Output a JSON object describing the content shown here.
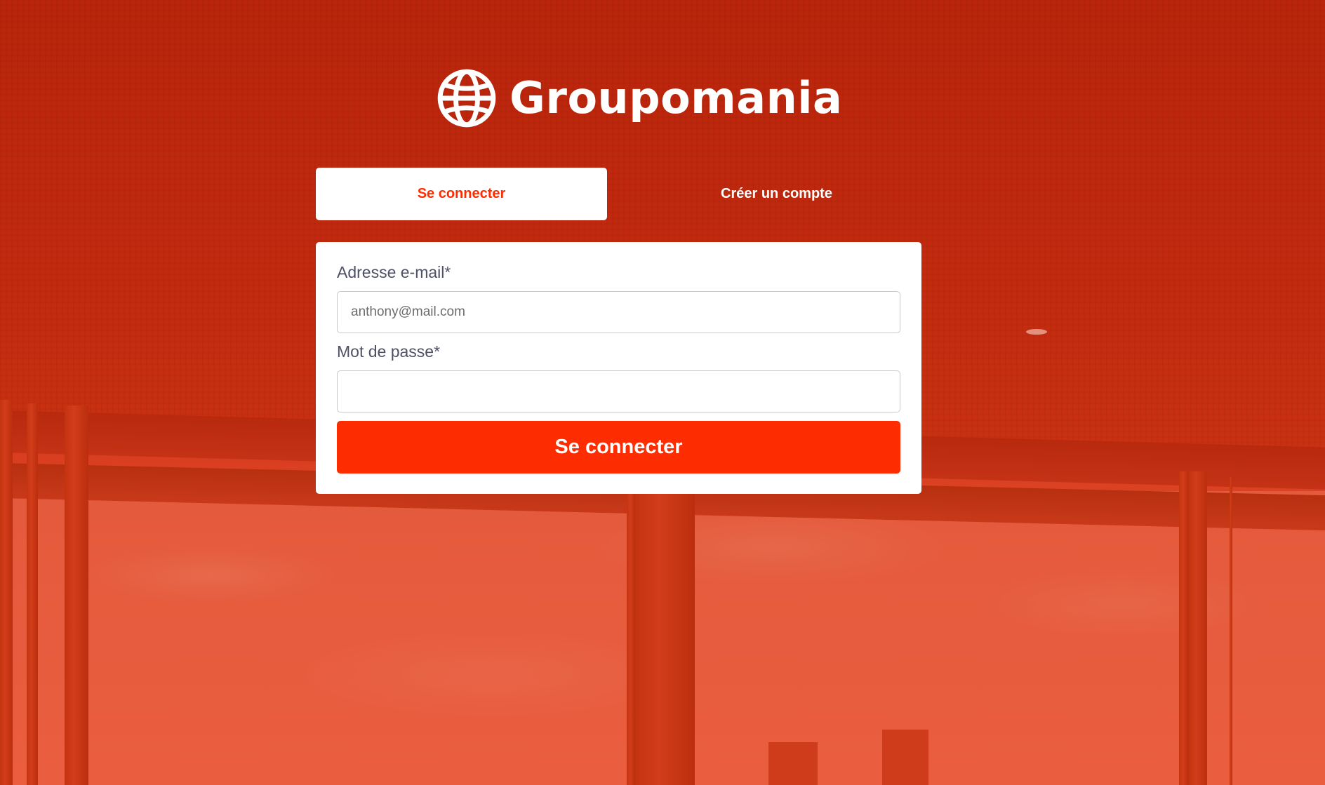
{
  "brand": {
    "name": "Groupomania",
    "icon": "globe-icon"
  },
  "tabs": [
    {
      "label": "Se connecter",
      "active": true
    },
    {
      "label": "Créer un compte",
      "active": false
    }
  ],
  "login_form": {
    "email_label": "Adresse e-mail*",
    "email_placeholder": "anthony@mail.com",
    "email_value": "",
    "password_label": "Mot de passe*",
    "password_value": "",
    "submit_label": "Se connecter"
  },
  "colors": {
    "primary": "#fd2d01",
    "label_text": "#4e5166",
    "background_tint": "#c32b0f"
  }
}
